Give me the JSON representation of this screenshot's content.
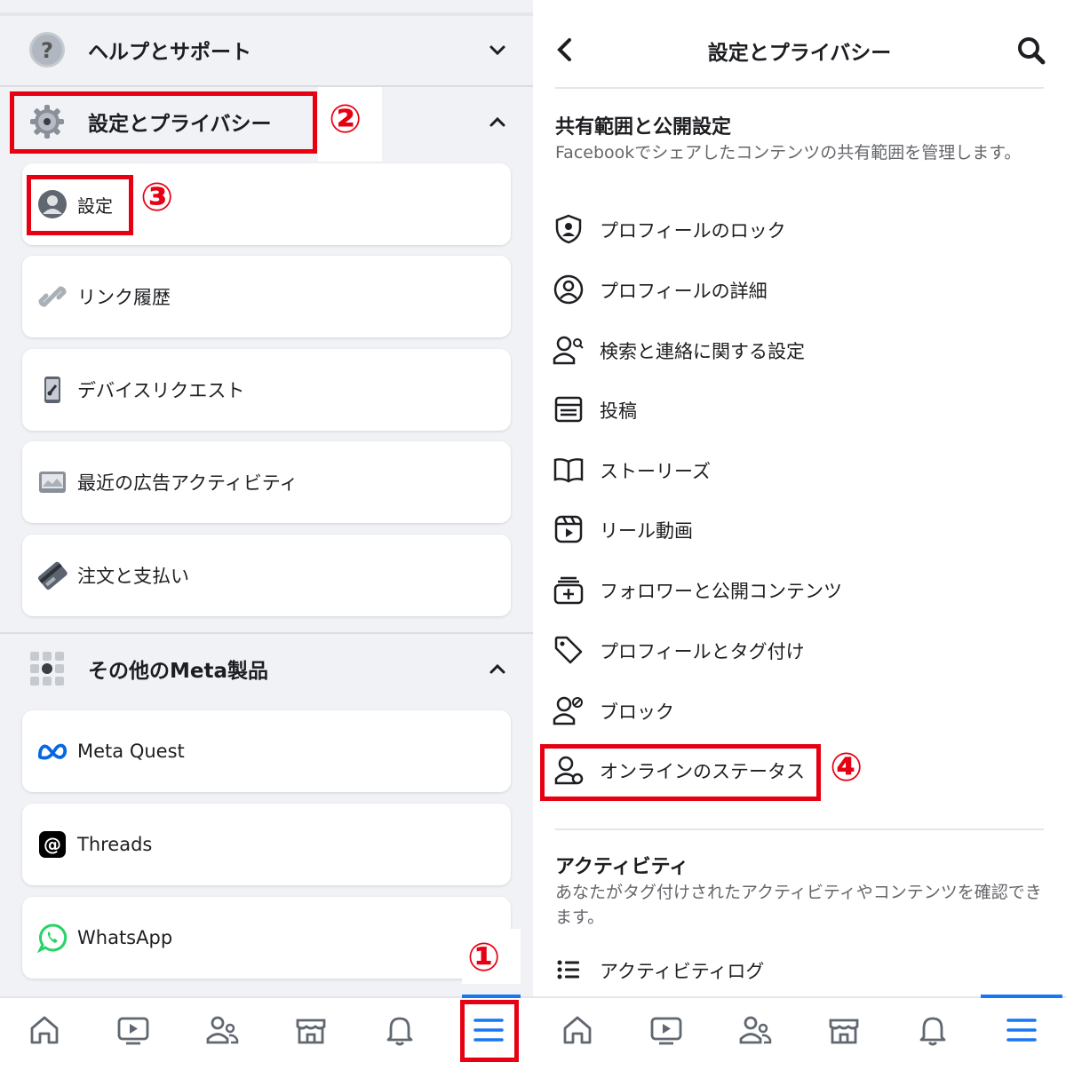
{
  "left": {
    "help_section": {
      "label": "ヘルプとサポート",
      "icon": "question-icon"
    },
    "settings_section": {
      "label": "設定とプライバシー",
      "icon": "gear-icon"
    },
    "settings_items": [
      {
        "label": "設定",
        "icon": "account-icon"
      },
      {
        "label": "リンク履歴",
        "icon": "link-icon"
      },
      {
        "label": "デバイスリクエスト",
        "icon": "device-icon"
      },
      {
        "label": "最近の広告アクティビティ",
        "icon": "ad-activity-icon"
      },
      {
        "label": "注文と支払い",
        "icon": "card-icon"
      }
    ],
    "meta_section": {
      "label": "その他のMeta製品",
      "icon": "grid-icon"
    },
    "meta_items": [
      {
        "label": "Meta Quest",
        "icon": "meta-logo-icon"
      },
      {
        "label": "Threads",
        "icon": "threads-icon"
      },
      {
        "label": "WhatsApp",
        "icon": "whatsapp-icon"
      }
    ]
  },
  "right": {
    "title": "設定とプライバシー",
    "section1": {
      "heading": "共有範囲と公開設定",
      "description": "Facebookでシェアしたコンテンツの共有範囲を管理します。",
      "items": [
        {
          "label": "プロフィールのロック",
          "icon": "profile-lock-icon"
        },
        {
          "label": "プロフィールの詳細",
          "icon": "profile-detail-icon"
        },
        {
          "label": "検索と連絡に関する設定",
          "icon": "person-search-icon"
        },
        {
          "label": "投稿",
          "icon": "post-icon"
        },
        {
          "label": "ストーリーズ",
          "icon": "book-icon"
        },
        {
          "label": "リール動画",
          "icon": "reels-icon"
        },
        {
          "label": "フォロワーと公開コンテンツ",
          "icon": "followers-icon"
        },
        {
          "label": "プロフィールとタグ付け",
          "icon": "tag-icon"
        },
        {
          "label": "ブロック",
          "icon": "block-icon"
        },
        {
          "label": "オンラインのステータス",
          "icon": "online-status-icon"
        }
      ]
    },
    "section2": {
      "heading": "アクティビティ",
      "description": "あなたがタグ付けされたアクティビティやコンテンツを確認できます。",
      "items": [
        {
          "label": "アクティビティログ",
          "icon": "list-icon"
        }
      ]
    }
  },
  "annotations": [
    "①",
    "②",
    "③",
    "④"
  ],
  "tabbar": [
    "home-icon",
    "video-icon",
    "friends-icon",
    "marketplace-icon",
    "bell-icon",
    "menu-icon"
  ],
  "colors": {
    "accent": "#1877f2",
    "annotation_red": "#e60012",
    "background": "#f0f2f5"
  }
}
